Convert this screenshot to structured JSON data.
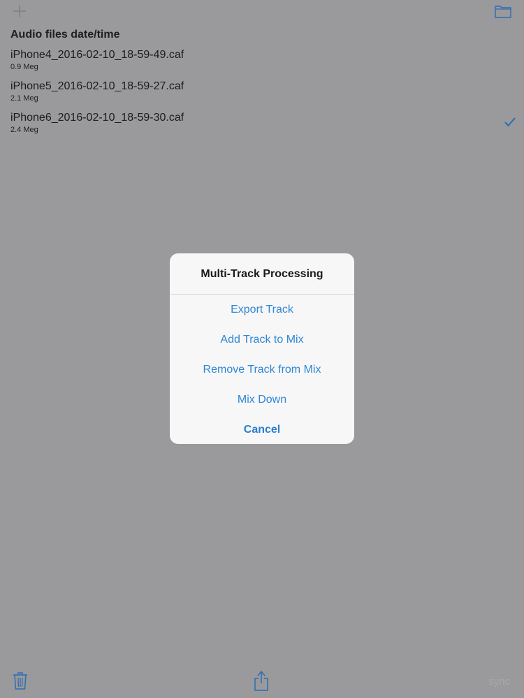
{
  "toolbar": {
    "add_icon": "plus-icon",
    "folder_icon": "folder-icon"
  },
  "list": {
    "header": "Audio files date/time",
    "files": [
      {
        "name": "iPhone4_2016-02-10_18-59-49.caf",
        "size": "0.9 Meg",
        "selected": false
      },
      {
        "name": "iPhone5_2016-02-10_18-59-27.caf",
        "size": "2.1 Meg",
        "selected": false
      },
      {
        "name": "iPhone6_2016-02-10_18-59-30.caf",
        "size": "2.4 Meg",
        "selected": true
      }
    ]
  },
  "alert": {
    "title": "Multi-Track Processing",
    "actions": [
      {
        "label": "Export Track"
      },
      {
        "label": "Add Track to Mix"
      },
      {
        "label": "Remove Track from Mix"
      },
      {
        "label": "Mix Down"
      }
    ],
    "cancel_label": "Cancel"
  },
  "bottom": {
    "trash_icon": "trash-icon",
    "share_icon": "share-icon",
    "sync_label": "sync"
  },
  "colors": {
    "background_dimmed": "#9a999b",
    "accent": "#2e86d6",
    "alert_bg": "#f7f7f7"
  }
}
